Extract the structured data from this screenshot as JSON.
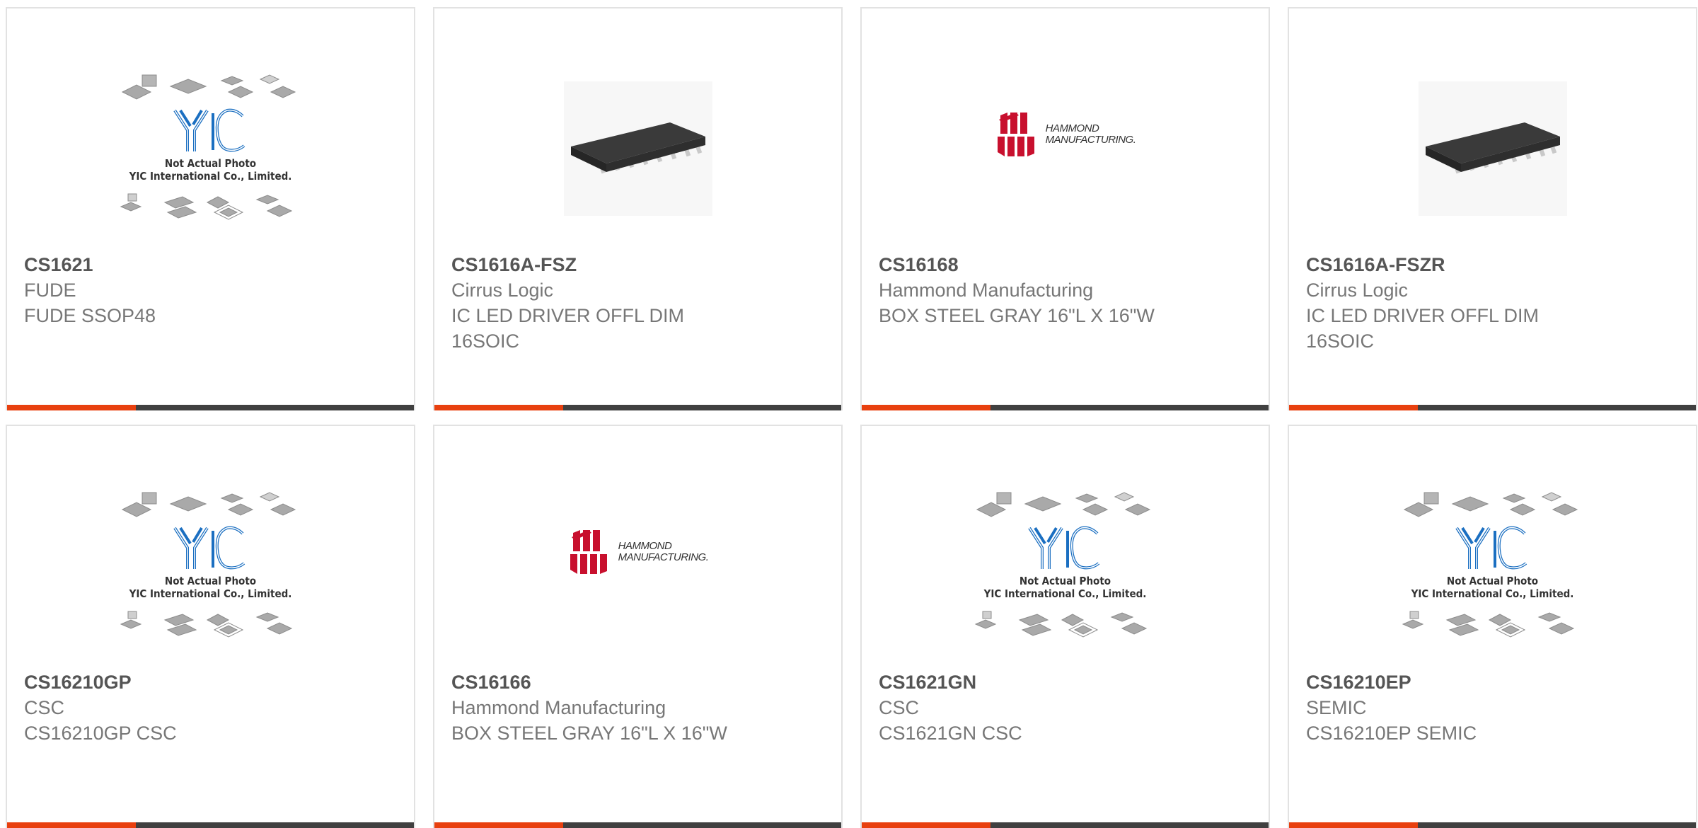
{
  "placeholder": {
    "line1": "Not Actual Photo",
    "line2": "YIC International Co., Limited.",
    "logo_text": "YIC"
  },
  "hammond_logo": {
    "line1": "HAMMOND",
    "line2": "MANUFACTURING."
  },
  "colors": {
    "accent": "#e8400f",
    "bar": "#404040",
    "yic_blue": "#1b6fc1",
    "hammond_red": "#c8102e"
  },
  "products": [
    {
      "part": "CS1621",
      "manufacturer": "FUDE",
      "description": "FUDE SSOP48",
      "image": "yic-placeholder"
    },
    {
      "part": "CS1616A-FSZ",
      "manufacturer": "Cirrus Logic",
      "description": "IC LED DRIVER OFFL DIM 16SOIC",
      "image": "soic-chip"
    },
    {
      "part": "CS16168",
      "manufacturer": "Hammond Manufacturing",
      "description": "BOX STEEL GRAY 16\"L X 16\"W",
      "image": "hammond-logo"
    },
    {
      "part": "CS1616A-FSZR",
      "manufacturer": "Cirrus Logic",
      "description": "IC LED DRIVER OFFL DIM 16SOIC",
      "image": "soic-chip"
    },
    {
      "part": "CS16210GP",
      "manufacturer": "CSC",
      "description": "CS16210GP CSC",
      "image": "yic-placeholder"
    },
    {
      "part": "CS16166",
      "manufacturer": "Hammond Manufacturing",
      "description": "BOX STEEL GRAY 16\"L X 16\"W",
      "image": "hammond-logo"
    },
    {
      "part": "CS1621GN",
      "manufacturer": "CSC",
      "description": "CS1621GN CSC",
      "image": "yic-placeholder"
    },
    {
      "part": "CS16210EP",
      "manufacturer": "SEMIC",
      "description": "CS16210EP SEMIC",
      "image": "yic-placeholder"
    }
  ]
}
